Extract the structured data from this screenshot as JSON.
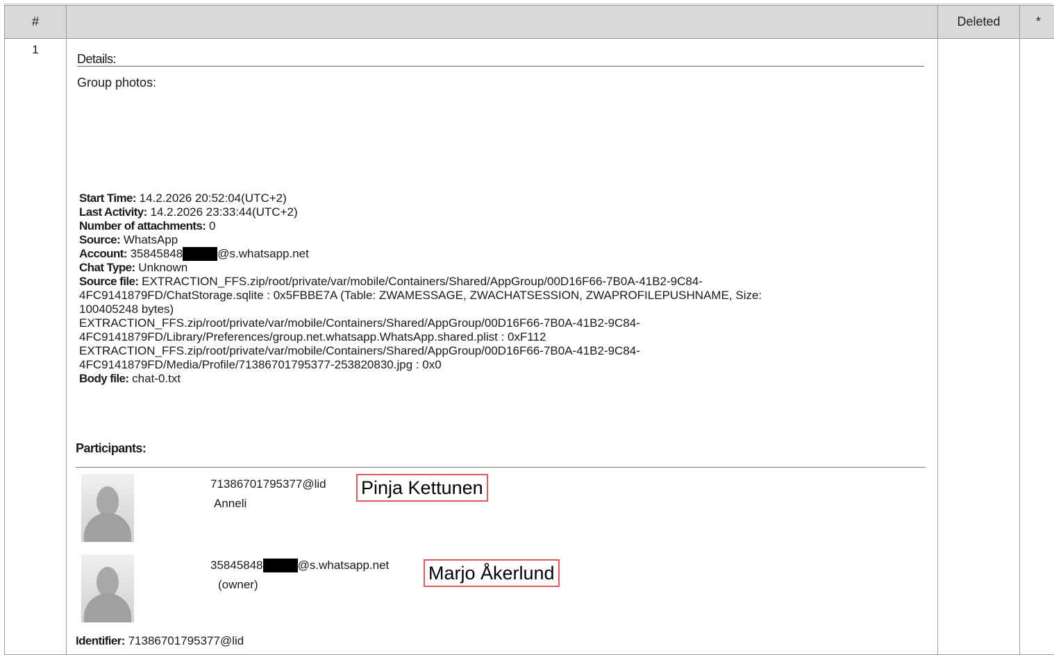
{
  "table": {
    "headers": {
      "num": "#",
      "main": "",
      "deleted": "Deleted",
      "star": "*"
    }
  },
  "row": {
    "num": "1",
    "details_label": "Details:",
    "group_photos": "Group photos:",
    "meta": {
      "start_time_label": "Start Time:",
      "start_time": " 14.2.2026 20:52:04(UTC+2)",
      "last_activity_label": "Last Activity:",
      "last_activity": " 14.2.2026 23:33:44(UTC+2)",
      "attachments_label": "Number of attachments:",
      "attachments": " 0",
      "source_label": "Source:",
      "source": " WhatsApp",
      "account_label": "Account:",
      "account_prefix": " 35845848",
      "account_suffix": "@s.whatsapp.net",
      "chat_type_label": "Chat Type:",
      "chat_type": " Unknown",
      "source_file_label": "Source file:",
      "source_file_lines": [
        " EXTRACTION_FFS.zip/root/private/var/mobile/Containers/Shared/AppGroup/00D16F66-7B0A-41B2-9C84-",
        "4FC9141879FD/ChatStorage.sqlite : 0x5FBBE7A (Table: ZWAMESSAGE, ZWACHATSESSION, ZWAPROFILEPUSHNAME, Size:",
        "100405248 bytes)",
        "EXTRACTION_FFS.zip/root/private/var/mobile/Containers/Shared/AppGroup/00D16F66-7B0A-41B2-9C84-",
        "4FC9141879FD/Library/Preferences/group.net.whatsapp.WhatsApp.shared.plist : 0xF112",
        "EXTRACTION_FFS.zip/root/private/var/mobile/Containers/Shared/AppGroup/00D16F66-7B0A-41B2-9C84-",
        "4FC9141879FD/Media/Profile/71386701795377-253820830.jpg : 0x0"
      ],
      "body_file_label": "Body file:",
      "body_file": " chat-0.txt"
    },
    "participants_label": "Participants:",
    "participants": [
      {
        "id": "71386701795377@lid",
        "name": "Anneli",
        "callout": "Pinja Kettunen"
      },
      {
        "id_prefix": "35845848",
        "id_suffix": "@s.whatsapp.net",
        "name": "(owner)",
        "callout": "Marjo Åkerlund"
      }
    ],
    "identifier_label": "Identifier:",
    "identifier": " 71386701795377@lid"
  }
}
